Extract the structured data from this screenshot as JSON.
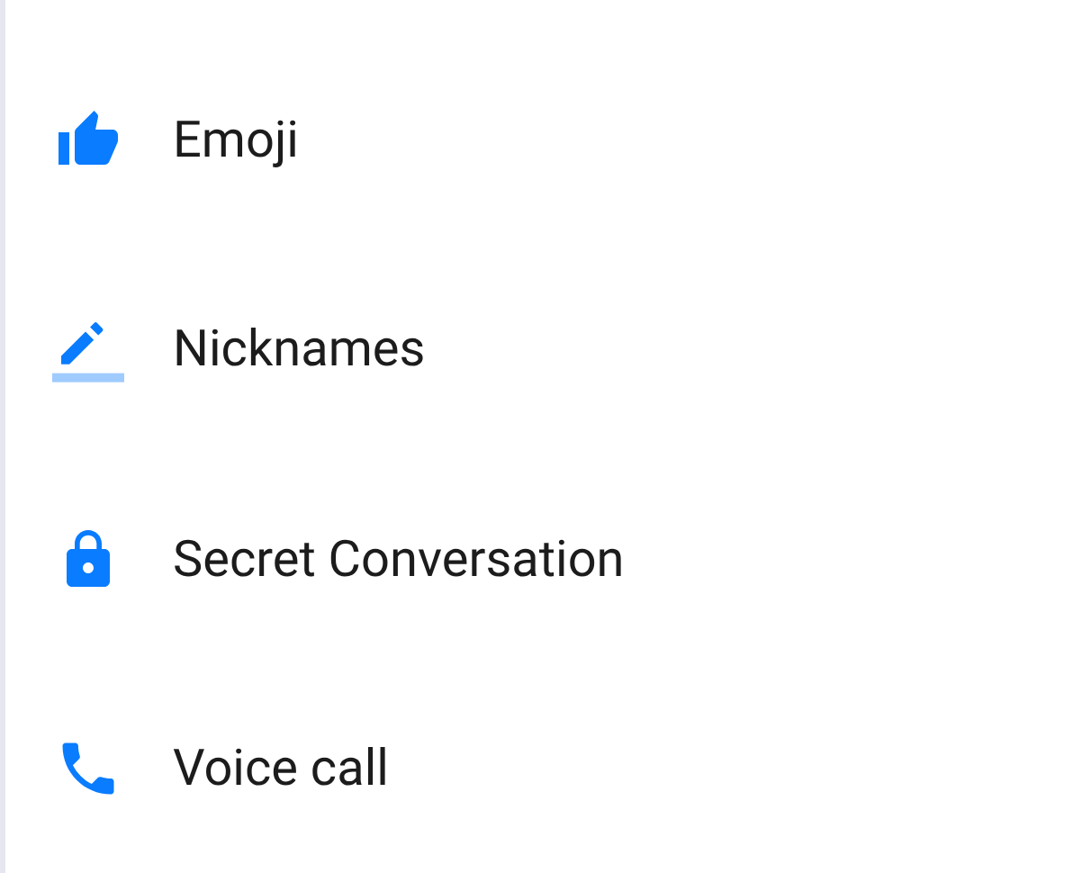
{
  "items": [
    {
      "kind": "emoji",
      "label": "Emoji"
    },
    {
      "kind": "nicknames",
      "label": "Nicknames"
    },
    {
      "kind": "secret",
      "label": "Secret Conversation"
    },
    {
      "kind": "call",
      "label": "Voice call"
    }
  ]
}
